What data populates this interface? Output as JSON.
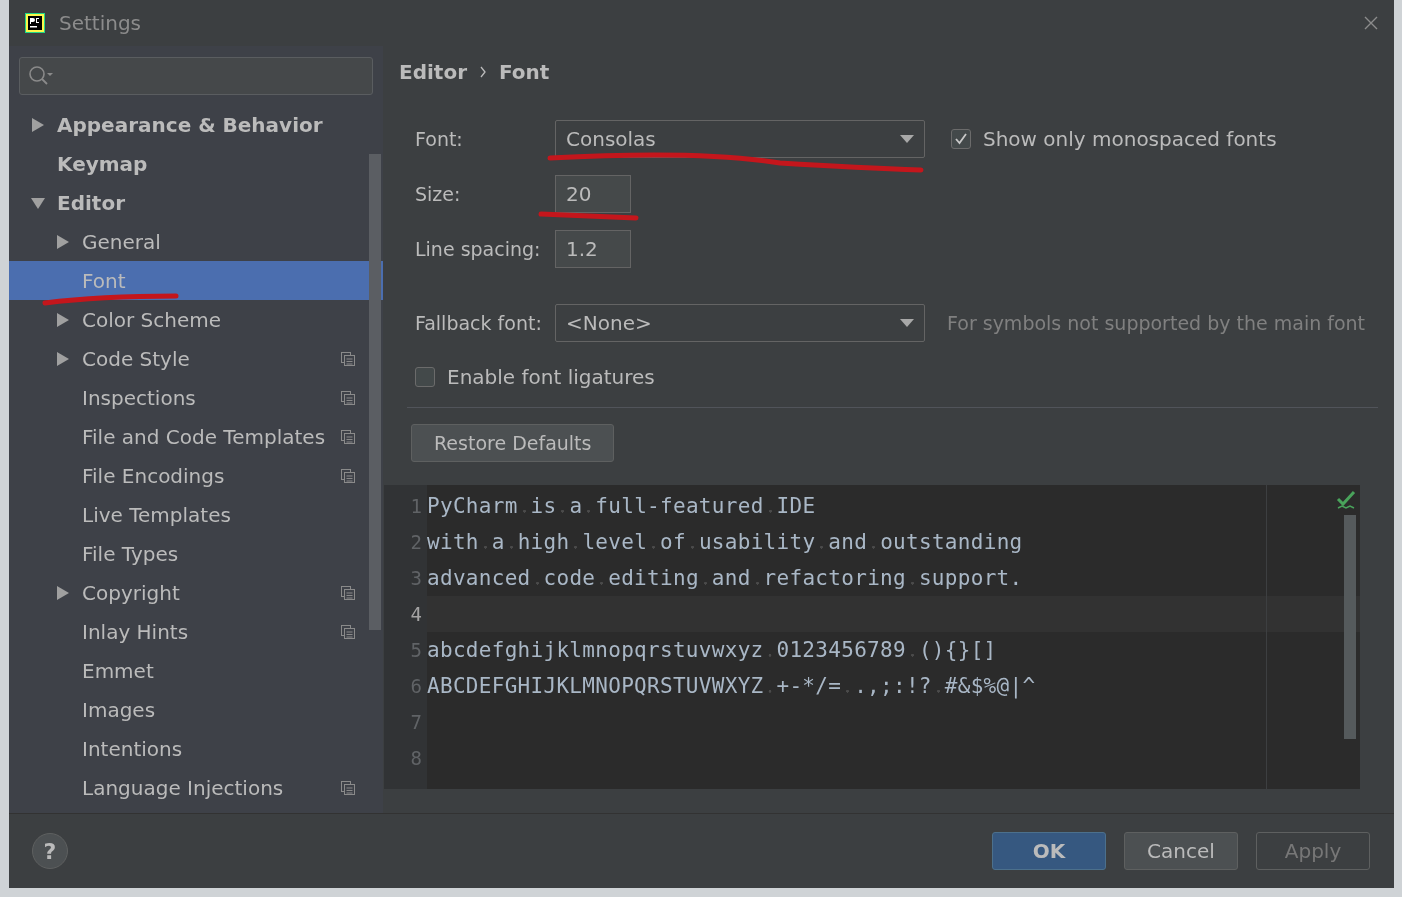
{
  "window": {
    "title": "Settings"
  },
  "tree": [
    {
      "label": "Appearance & Behavior",
      "bold": true,
      "expanded": false,
      "selected": false
    },
    {
      "label": "Keymap",
      "bold": true,
      "selected": false
    },
    {
      "label": "Editor",
      "bold": true,
      "expanded": true,
      "selected": false,
      "children": [
        {
          "label": "General",
          "expanded": false,
          "selected": false,
          "project_scoped": false
        },
        {
          "label": "Font",
          "selected": true,
          "project_scoped": false
        },
        {
          "label": "Color Scheme",
          "expanded": false,
          "selected": false,
          "project_scoped": false
        },
        {
          "label": "Code Style",
          "expanded": false,
          "selected": false,
          "project_scoped": true
        },
        {
          "label": "Inspections",
          "selected": false,
          "project_scoped": true
        },
        {
          "label": "File and Code Templates",
          "selected": false,
          "project_scoped": true
        },
        {
          "label": "File Encodings",
          "selected": false,
          "project_scoped": true
        },
        {
          "label": "Live Templates",
          "selected": false,
          "project_scoped": false
        },
        {
          "label": "File Types",
          "selected": false,
          "project_scoped": false
        },
        {
          "label": "Copyright",
          "expanded": false,
          "selected": false,
          "project_scoped": true
        },
        {
          "label": "Inlay Hints",
          "selected": false,
          "project_scoped": true
        },
        {
          "label": "Emmet",
          "selected": false,
          "project_scoped": false
        },
        {
          "label": "Images",
          "selected": false,
          "project_scoped": false
        },
        {
          "label": "Intentions",
          "selected": false,
          "project_scoped": false
        },
        {
          "label": "Language Injections",
          "selected": false,
          "project_scoped": true
        }
      ]
    }
  ],
  "breadcrumb": [
    "Editor",
    "Font"
  ],
  "font": {
    "label": "Font:",
    "value": "Consolas"
  },
  "show_monospaced": {
    "label": "Show only monospaced fonts",
    "checked": true
  },
  "size": {
    "label": "Size:",
    "value": "20"
  },
  "line_spacing": {
    "label": "Line spacing:",
    "value": "1.2"
  },
  "fallback": {
    "label": "Fallback font:",
    "value": "<None>",
    "hint": "For symbols not supported by the main font"
  },
  "ligatures": {
    "label": "Enable font ligatures",
    "checked": false
  },
  "restore_button": "Restore Defaults",
  "preview": [
    {
      "number": "1",
      "text": "PyCharm is a full-featured IDE",
      "current": false
    },
    {
      "number": "2",
      "text": "with a high level of usability and outstanding",
      "current": false
    },
    {
      "number": "3",
      "text": "advanced code editing and refactoring support.",
      "current": false
    },
    {
      "number": "4",
      "current": true
    },
    {
      "number": "5",
      "text": "abcdefghijklmnopqrstuvwxyz 0123456789 (){}[]",
      "current": false
    },
    {
      "number": "6",
      "text": "ABCDEFGHIJKLMNOPQRSTUVWXYZ +-*/= .,;:!? #&$%@|^",
      "current": false
    },
    {
      "number": "7",
      "current": false
    },
    {
      "number": "8",
      "current": false
    }
  ],
  "help_button": "?",
  "buttons": [
    {
      "label": "OK",
      "primary": true,
      "disabled": false
    },
    {
      "label": "Cancel",
      "primary": false,
      "disabled": false
    },
    {
      "label": "Apply",
      "primary": false,
      "disabled": true
    }
  ]
}
